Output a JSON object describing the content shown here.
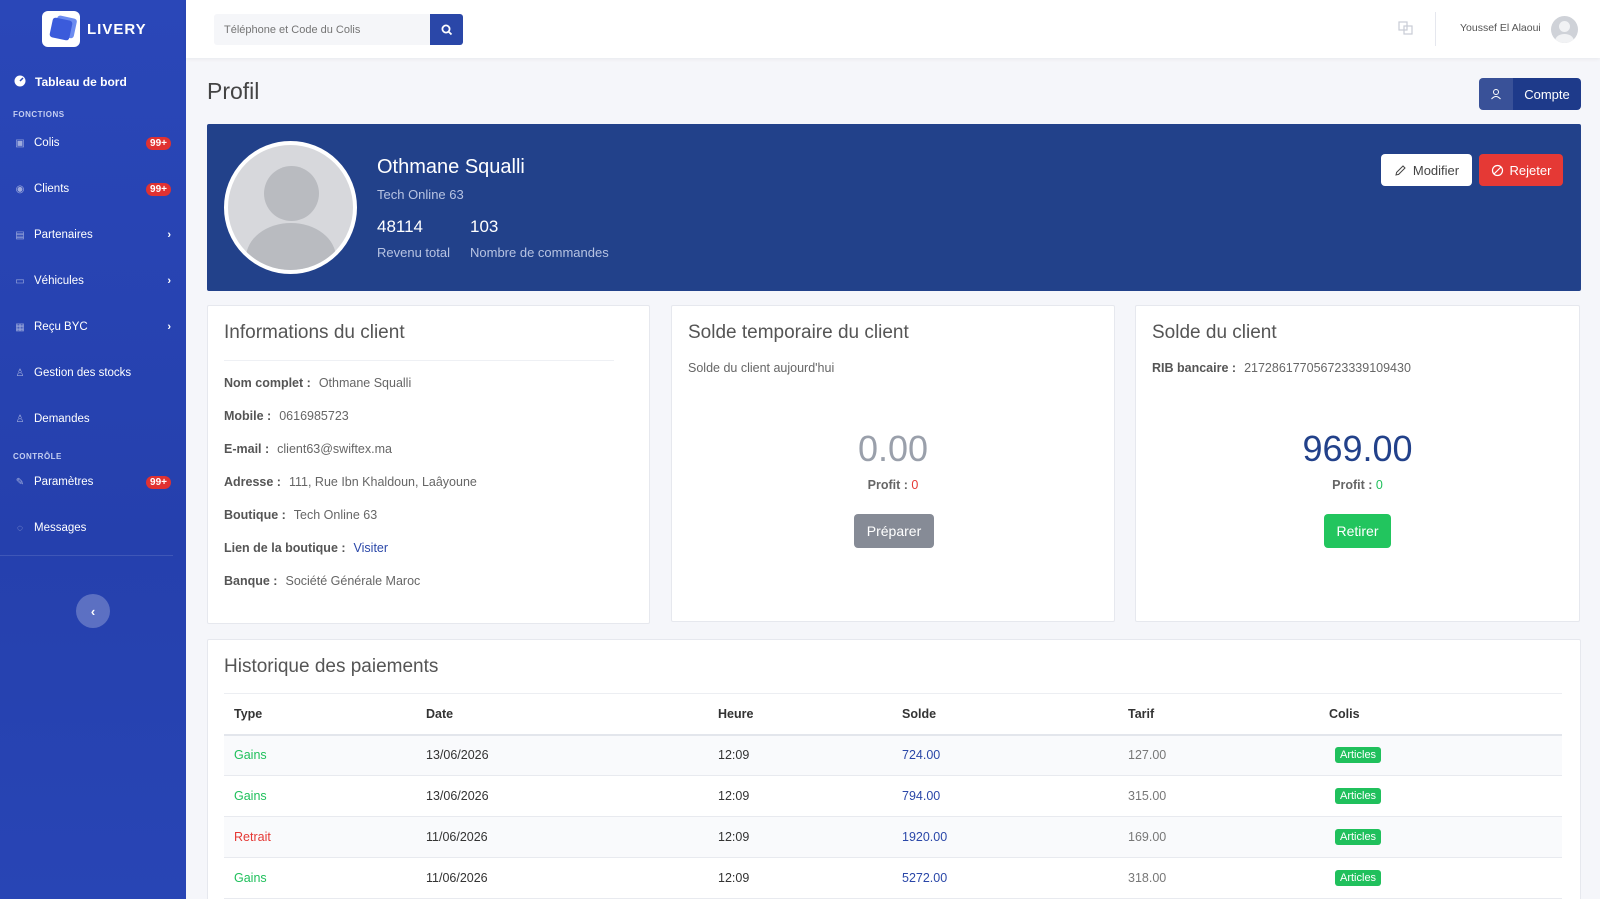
{
  "brand": {
    "name": "LIVERY"
  },
  "sidebar": {
    "dashboard": "Tableau de bord",
    "section_functions": "FONCTIONS",
    "section_control": "CONTRÔLE",
    "items": [
      {
        "label": "Colis",
        "badge": "99+",
        "icon": "box-icon"
      },
      {
        "label": "Clients",
        "badge": "99+",
        "icon": "user-circle-icon"
      },
      {
        "label": "Partenaires",
        "icon": "building-icon"
      },
      {
        "label": "Véhicules",
        "icon": "truck-icon"
      },
      {
        "label": "Reçu BYC",
        "icon": "grid-icon"
      },
      {
        "label": "Gestion des stocks",
        "icon": "user-icon"
      },
      {
        "label": "Demandes",
        "icon": "user-icon"
      }
    ],
    "control_items": [
      {
        "label": "Paramètres",
        "badge": "99+",
        "icon": "wrench-icon"
      },
      {
        "label": "Messages",
        "icon": "chat-icon"
      }
    ]
  },
  "topbar": {
    "search_placeholder": "Téléphone et Code du Colis",
    "user_name": "Youssef El Alaoui"
  },
  "page": {
    "title": "Profil",
    "compte_button": "Compte"
  },
  "hero": {
    "name": "Othmane Squalli",
    "shop": "Tech Online 63",
    "stats": [
      {
        "value": "48114",
        "label": "Revenu total"
      },
      {
        "value": "103",
        "label": "Nombre de commandes"
      }
    ],
    "modify_button": "Modifier",
    "reject_button": "Rejeter"
  },
  "client_info": {
    "title": "Informations du client",
    "rows": [
      {
        "label": "Nom complet :",
        "value": "Othmane Squalli"
      },
      {
        "label": "Mobile :",
        "value": "0616985723"
      },
      {
        "label": "E-mail :",
        "value": "client63@swiftex.ma"
      },
      {
        "label": "Adresse :",
        "value": "111, Rue Ibn Khaldoun, Laâyoune"
      },
      {
        "label": "Boutique :",
        "value": "Tech Online 63"
      },
      {
        "label": "Lien de la boutique :",
        "value": "Visiter"
      },
      {
        "label": "Banque :",
        "value": "Société Générale Maroc"
      }
    ]
  },
  "temp_balance": {
    "title": "Solde temporaire du client",
    "subtitle": "Solde du client aujourd'hui",
    "amount": "0.00",
    "profit_label": "Profit :",
    "profit_value": "0",
    "button": "Préparer",
    "color_amount": "#9aa0ab"
  },
  "balance": {
    "title": "Solde du client",
    "rib_label": "RIB bancaire :",
    "rib_value": "21728617705672333910943​0",
    "amount": "969.00",
    "profit_label": "Profit :",
    "profit_value": "0",
    "button": "Retirer",
    "color_amount": "#22418a"
  },
  "history": {
    "title": "Historique des paiements",
    "columns": [
      "Type",
      "Date",
      "Heure",
      "Solde",
      "Tarif",
      "Colis"
    ],
    "rows": [
      {
        "type": "Gains",
        "date": "13/06/2026",
        "time": "12:09",
        "solde": "724.00",
        "tarif": "127.00",
        "colis": "Articles"
      },
      {
        "type": "Gains",
        "date": "13/06/2026",
        "time": "12:09",
        "solde": "794.00",
        "tarif": "315.00",
        "colis": "Articles"
      },
      {
        "type": "Retrait",
        "date": "11/06/2026",
        "time": "12:09",
        "solde": "1920.00",
        "tarif": "169.00",
        "colis": "Articles"
      },
      {
        "type": "Gains",
        "date": "11/06/2026",
        "time": "12:09",
        "solde": "5272.00",
        "tarif": "318.00",
        "colis": "Articles"
      }
    ]
  }
}
